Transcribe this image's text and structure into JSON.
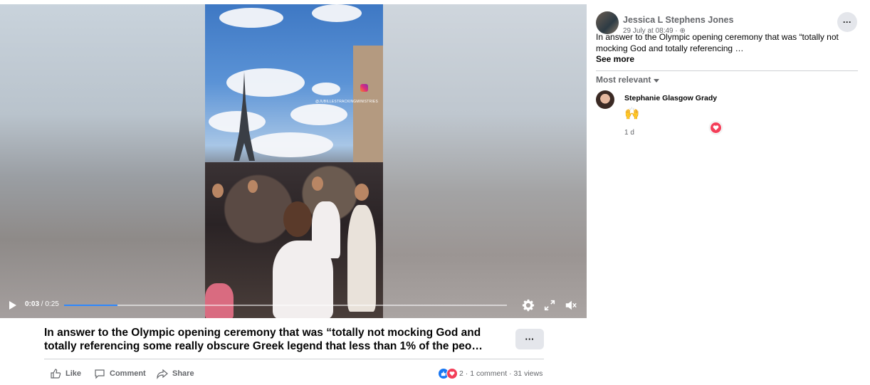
{
  "video": {
    "current_time": "0:03",
    "separator": " / ",
    "duration": "0:25",
    "progress": 0.12,
    "watermark": "@JUBILLESTRACKINGMINISTRIES",
    "icons": [
      "play-icon",
      "settings-icon",
      "fullscreen-icon",
      "volume-muted-icon"
    ]
  },
  "post": {
    "caption_line1": "In answer to the Olympic opening ceremony that was “totally not mocking God and",
    "caption_line2": "totally referencing some really obscure Greek legend that less than 1% of the peo…",
    "more_label": "···",
    "actions": {
      "like": "Like",
      "comment": "Comment",
      "share": "Share"
    },
    "stats": {
      "reaction_count": "2",
      "comments": "1 comment",
      "views": "31 views",
      "dot": " · "
    }
  },
  "panel": {
    "author": "Jessica L Stephens Jones",
    "time": "29 July at 08:49 · ",
    "text": "In answer to the Olympic opening ceremony that was “totally not mocking God and totally referencing …",
    "see_more": "See more",
    "sort_label": "Most relevant",
    "more_label": "···",
    "comment": {
      "name": "Stephanie Glasgow Grady",
      "emoji": "🙌",
      "time": "1 d"
    }
  },
  "colors": {
    "accent": "#1877f2",
    "love": "#f33e58",
    "secondary_text": "#65676b"
  }
}
